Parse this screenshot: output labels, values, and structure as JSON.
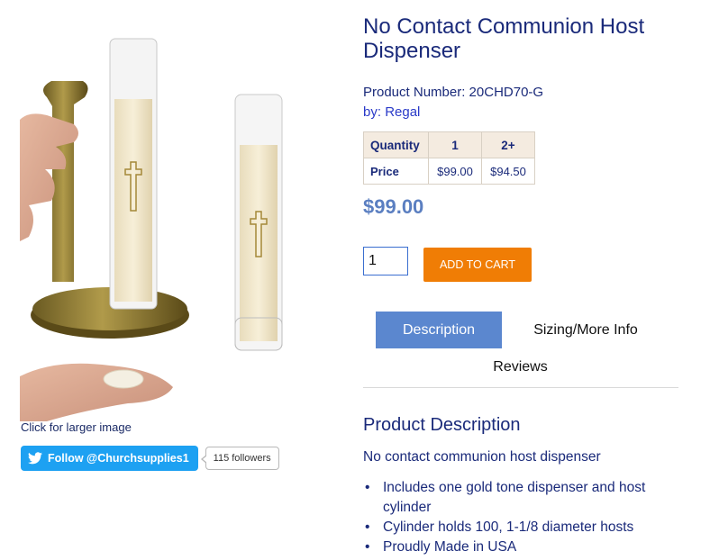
{
  "image": {
    "alt": "No Contact Communion Host Dispenser",
    "caption": "Click for larger image"
  },
  "twitter": {
    "follow_label": "Follow @Churchsupplies1",
    "followers": "115 followers",
    "brand_color": "#1da1f2"
  },
  "product": {
    "title": "No Contact Communion Host Dispenser",
    "number_label": "Product Number: 20CHD70-G",
    "by_prefix": "by:",
    "by_brand": "Regal",
    "price": "$99.00",
    "price_color": "#5b7fc1"
  },
  "price_table": {
    "headers": [
      "Quantity",
      "1",
      "2+"
    ],
    "row_label": "Price",
    "values": [
      "$99.00",
      "$94.50"
    ]
  },
  "cart": {
    "quantity": "1",
    "add_label": "ADD TO CART",
    "button_color": "#f07d05"
  },
  "tabs": [
    {
      "label": "Description",
      "active": true
    },
    {
      "label": "Sizing/More Info",
      "active": false
    },
    {
      "label": "Reviews",
      "active": false
    }
  ],
  "description": {
    "heading": "Product Description",
    "intro": "No contact communion host dispenser",
    "features": [
      "Includes one gold tone dispenser and host cylinder",
      "Cylinder holds 100, 1-1/8 diameter hosts",
      "Proudly Made in USA"
    ]
  }
}
